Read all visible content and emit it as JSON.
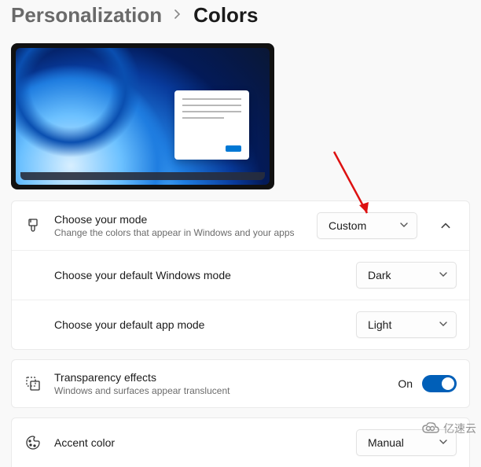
{
  "breadcrumb": {
    "parent": "Personalization",
    "current": "Colors"
  },
  "mode": {
    "title": "Choose your mode",
    "desc": "Change the colors that appear in Windows and your apps",
    "value": "Custom",
    "win_mode_title": "Choose your default Windows mode",
    "win_mode_value": "Dark",
    "app_mode_title": "Choose your default app mode",
    "app_mode_value": "Light"
  },
  "transparency": {
    "title": "Transparency effects",
    "desc": "Windows and surfaces appear translucent",
    "state_label": "On"
  },
  "accent": {
    "title": "Accent color",
    "value": "Manual"
  },
  "watermark": {
    "text": "亿速云"
  }
}
